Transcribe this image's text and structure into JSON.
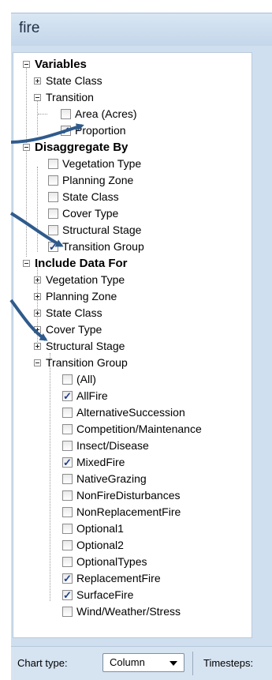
{
  "window": {
    "title": "fire"
  },
  "tree": {
    "variables": {
      "label": "Variables",
      "state_class": "State Class",
      "transition": "Transition",
      "area": "Area (Acres)",
      "proportion": "Proportion"
    },
    "disaggregate": {
      "label": "Disaggregate By",
      "items": [
        "Vegetation Type",
        "Planning Zone",
        "State Class",
        "Cover Type",
        "Structural Stage",
        "Transition Group"
      ]
    },
    "include": {
      "label": "Include Data For",
      "items": [
        "Vegetation Type",
        "Planning Zone",
        "State Class",
        "Cover Type",
        "Structural Stage",
        "Transition Group"
      ],
      "groups": [
        "(All)",
        "AllFire",
        "AlternativeSuccession",
        "Competition/Maintenance",
        "Insect/Disease",
        "MixedFire",
        "NativeGrazing",
        "NonFireDisturbances",
        "NonReplacementFire",
        "Optional1",
        "Optional2",
        "OptionalTypes",
        "ReplacementFire",
        "SurfaceFire",
        "Wind/Weather/Stress"
      ]
    }
  },
  "checked": {
    "proportion": true,
    "transition_group": true,
    "groups": [
      "AllFire",
      "MixedFire",
      "ReplacementFire",
      "SurfaceFire"
    ]
  },
  "footer": {
    "chart_type_label": "Chart type:",
    "chart_type_value": "Column",
    "timesteps_label": "Timesteps:"
  },
  "colors": {
    "arrow": "#2f5b8c",
    "check": "#1f3f8f"
  }
}
